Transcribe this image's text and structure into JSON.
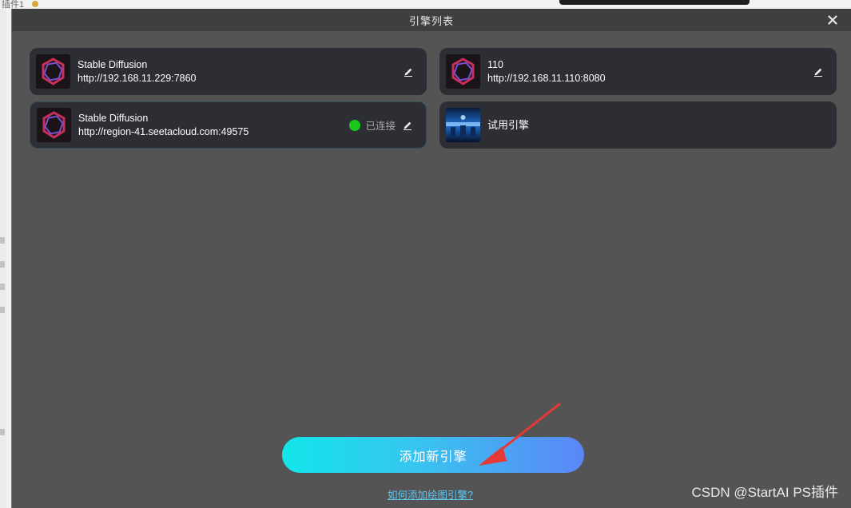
{
  "background": {
    "top_left_text": "插件1"
  },
  "modal": {
    "title": "引擎列表"
  },
  "engines": [
    {
      "name": "Stable Diffusion",
      "url": "http://192.168.11.229:7860",
      "icon": "stable-diffusion-logo",
      "connected": false
    },
    {
      "name": "110",
      "url": "http://192.168.11.110:8080",
      "icon": "stable-diffusion-logo",
      "connected": false
    },
    {
      "name": "Stable Diffusion",
      "url": "http://region-41.seetacloud.com:49575",
      "icon": "stable-diffusion-logo",
      "connected": true,
      "status_label": "已连接",
      "status_color": "#18c81a"
    },
    {
      "name": "试用引擎",
      "icon": "trial-engine-thumbnail",
      "connected": false
    }
  ],
  "actions": {
    "add_engine_label": "添加新引擎",
    "help_link_label": "如何添加绘图引擎?"
  },
  "watermark": "CSDN @StartAI PS插件",
  "colors": {
    "modal_bg": "#545454",
    "header_bg": "#3f3f3f",
    "card_bg": "#2d2e33",
    "accent_gradient_start": "#12e6ea",
    "accent_gradient_end": "#5b86f7",
    "link": "#5fc5f0",
    "annotation_arrow": "#e53935"
  }
}
